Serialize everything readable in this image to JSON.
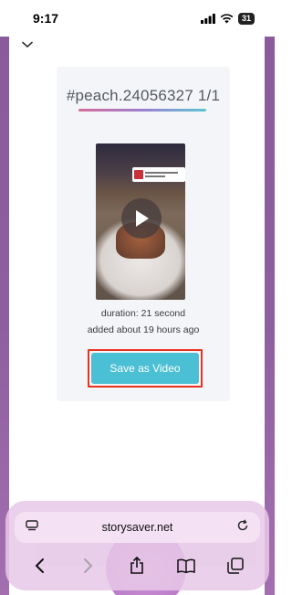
{
  "status_bar": {
    "time": "9:17",
    "battery": "31",
    "icons": [
      "signal-icon",
      "wifi-icon",
      "battery-icon"
    ]
  },
  "page": {
    "collapse_icon": "chevron-down-icon"
  },
  "story_card": {
    "title": "#peach.24056327 1/1",
    "underline_colors": [
      "#d66b9b",
      "#9b7fd0",
      "#5cc6d2"
    ],
    "thumbnail_icon": "play-icon",
    "duration": "duration: 21 second",
    "added": "added about 19 hours ago",
    "save_button_label": "Save as Video",
    "save_button_color": "#4bbfd4",
    "highlight_color": "#e8341f"
  },
  "browser": {
    "url": "storysaver.net",
    "url_left_icon": "page-menu-icon",
    "url_right_icon": "reload-icon",
    "toolbar_icons": [
      "back-icon",
      "forward-icon",
      "share-icon",
      "bookmarks-icon",
      "tabs-icon"
    ]
  }
}
